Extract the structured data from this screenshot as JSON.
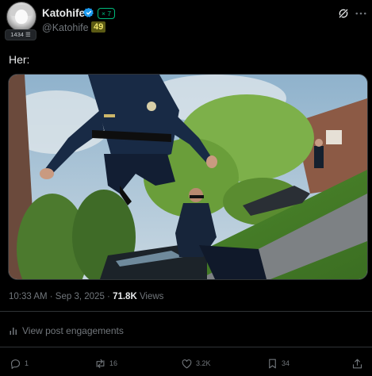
{
  "author": {
    "display_name": "Katohife",
    "handle": "@Katohife",
    "handle_badge": "49",
    "followers_pill": "× 7",
    "avatar_badge": "1434 ☰"
  },
  "post": {
    "text": "Her:",
    "time": "10:33 AM · Sep 3, 2025 · ",
    "views_count": "71.8K",
    "views_label": " Views"
  },
  "engagements_label": "View post engagements",
  "actions": {
    "replies": "1",
    "reposts": "16",
    "likes": "3.2K",
    "bookmarks": "34"
  },
  "colors": {
    "background": "#000000",
    "text": "#e7e9ea",
    "muted": "#71767b",
    "verified_blue": "#1d9bf0",
    "green_pill": "#00ba7c",
    "badge_yellow": "#f1e66b"
  },
  "icons": [
    "verified-icon",
    "grok-icon",
    "more-icon",
    "engagements-icon",
    "reply-icon",
    "repost-icon",
    "like-icon",
    "bookmark-icon",
    "share-icon"
  ]
}
